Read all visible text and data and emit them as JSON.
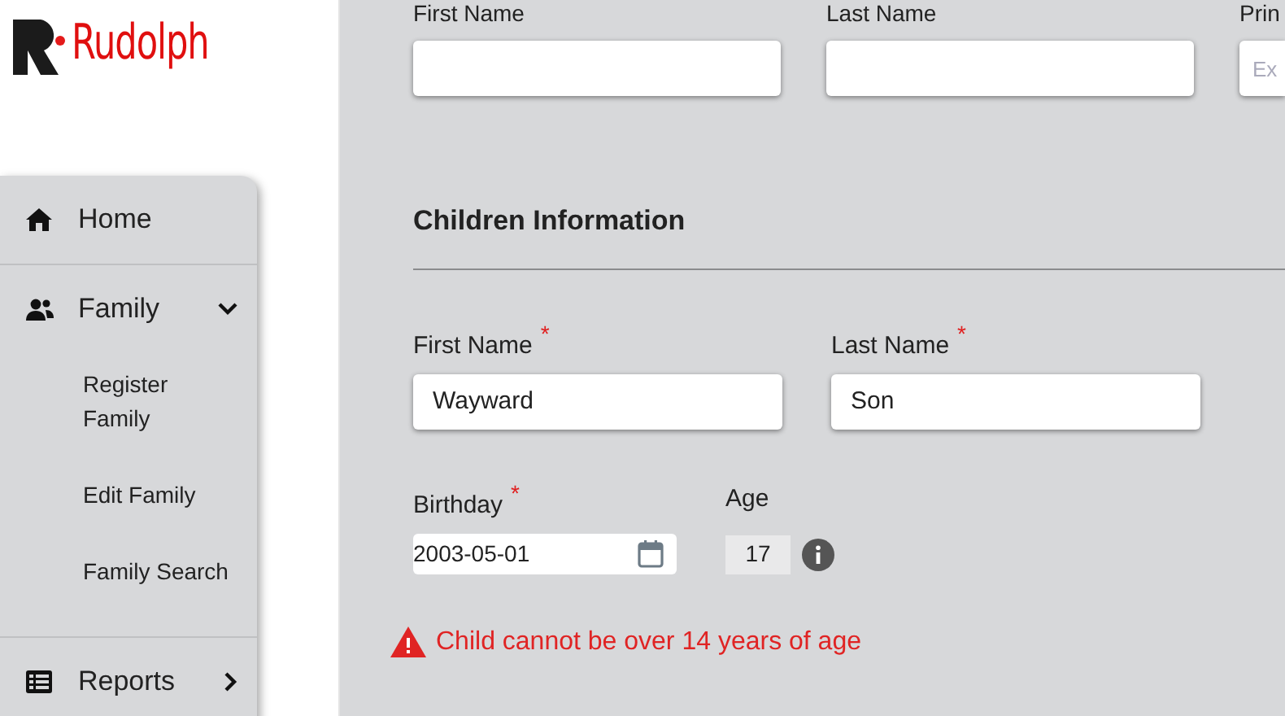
{
  "brand": {
    "name": "Rudolph"
  },
  "nav": [
    {
      "kind": "link",
      "label": "Home"
    },
    {
      "kind": "group",
      "label": "Family",
      "expanded": true,
      "children": [
        {
          "label": "Register Family"
        },
        {
          "label": "Edit Family"
        },
        {
          "label": "Family Search"
        }
      ]
    },
    {
      "kind": "group",
      "label": "Reports",
      "expanded": false
    }
  ],
  "parent_fields": [
    {
      "label": "First Name"
    },
    {
      "label": "Last Name"
    },
    {
      "label": "Prin",
      "placeholder": "Ex"
    }
  ],
  "section": {
    "title": "Children Information"
  },
  "child_fields": [
    {
      "label": "First Name",
      "required_mark": "*",
      "value": "Wayward"
    },
    {
      "label": "Last Name",
      "required_mark": "*",
      "value": "Son"
    }
  ],
  "birthday": {
    "label": "Birthday",
    "required_mark": "*",
    "value": "2003-05-01"
  },
  "age": {
    "label": "Age",
    "value": "17"
  },
  "error": {
    "message": "Child cannot be over 14 years of age"
  }
}
